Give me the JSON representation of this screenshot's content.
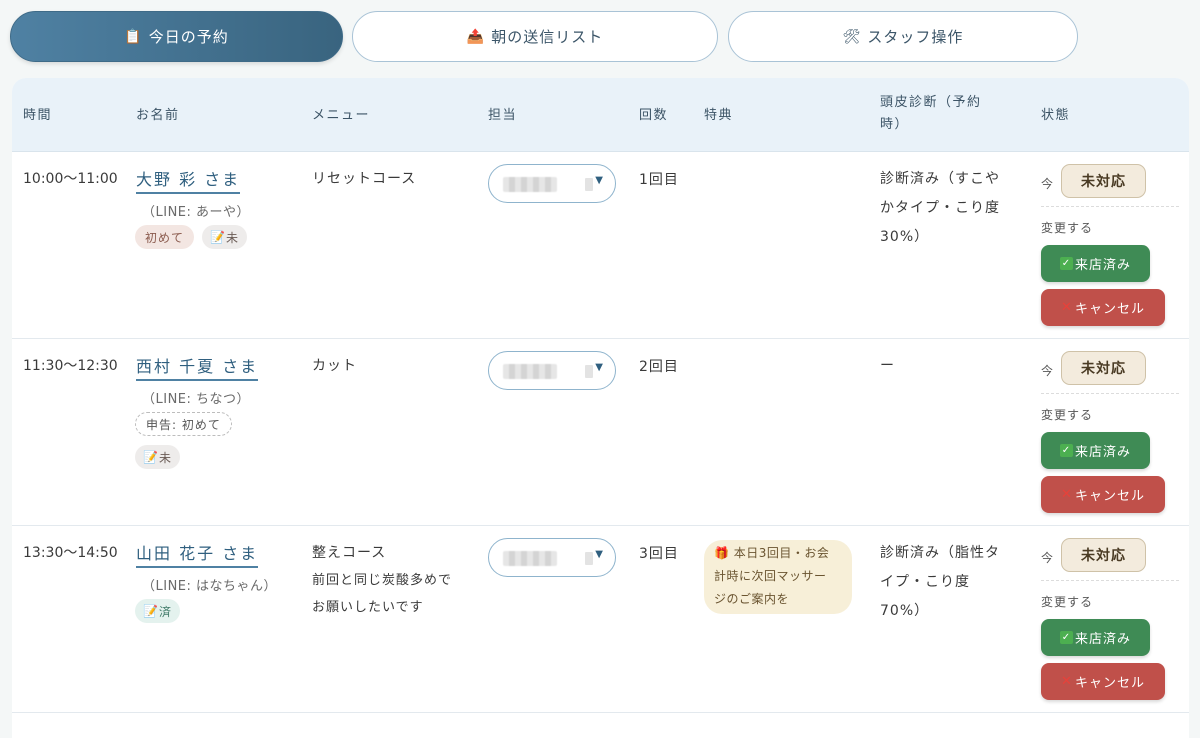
{
  "tabs": [
    {
      "icon": "📋",
      "label": "今日の予約"
    },
    {
      "icon": "📤",
      "label": "朝の送信リスト"
    },
    {
      "icon": "🛠",
      "label": "スタッフ操作"
    }
  ],
  "headers": {
    "time": "時間",
    "name": "お名前",
    "menu": "メニュー",
    "staff": "担当",
    "count": "回数",
    "perk": "特典",
    "diagnosis_1": "頭皮診断（予約",
    "diagnosis_2": "時）",
    "status": "状態"
  },
  "rows": [
    {
      "time": "10:00〜11:00",
      "name": "大野 彩 さま",
      "line": "（LINE: あーや）",
      "first_tag": "初めて",
      "memo_tag": "未",
      "menu": "リセットコース",
      "count": "1回目",
      "diag_1": "診断済み（すこや",
      "diag_2": "かタイプ・こり度",
      "diag_3": "30%）",
      "now": "今",
      "status": "未対応",
      "change": "変更する",
      "visited": "来店済み",
      "cancel": "キャンセル"
    },
    {
      "time": "11:30〜12:30",
      "name": "西村 千夏 さま",
      "line": "（LINE: ちなつ）",
      "declared_tag": "申告: 初めて",
      "memo_tag": "未",
      "menu": "カット",
      "count": "2回目",
      "diag_1": "ー",
      "now": "今",
      "status": "未対応",
      "change": "変更する",
      "visited": "来店済み",
      "cancel": "キャンセル"
    },
    {
      "time": "13:30〜14:50",
      "name": "山田 花子 さま",
      "line": "（LINE: はなちゃん）",
      "memo_tag": "済",
      "menu": "整えコース",
      "note_1": "前回と同じ炭酸多めで",
      "note_2": "お願いしたいです",
      "count": "3回目",
      "perk_1": "本日3回目・お会",
      "perk_2": "計時に次回マッサー",
      "perk_3": "ジのご案内を",
      "diag_1": "診断済み（脂性タ",
      "diag_2": "イプ・こり度",
      "diag_3": "70%）",
      "now": "今",
      "status": "未対応",
      "change": "変更する",
      "visited": "来店済み",
      "cancel": "キャンセル"
    }
  ],
  "colors": {
    "tab_active": "#4f81a3",
    "visited_button": "#3f8b55",
    "cancel_button": "#c0504a",
    "status_badge": "#f3ebdd"
  }
}
